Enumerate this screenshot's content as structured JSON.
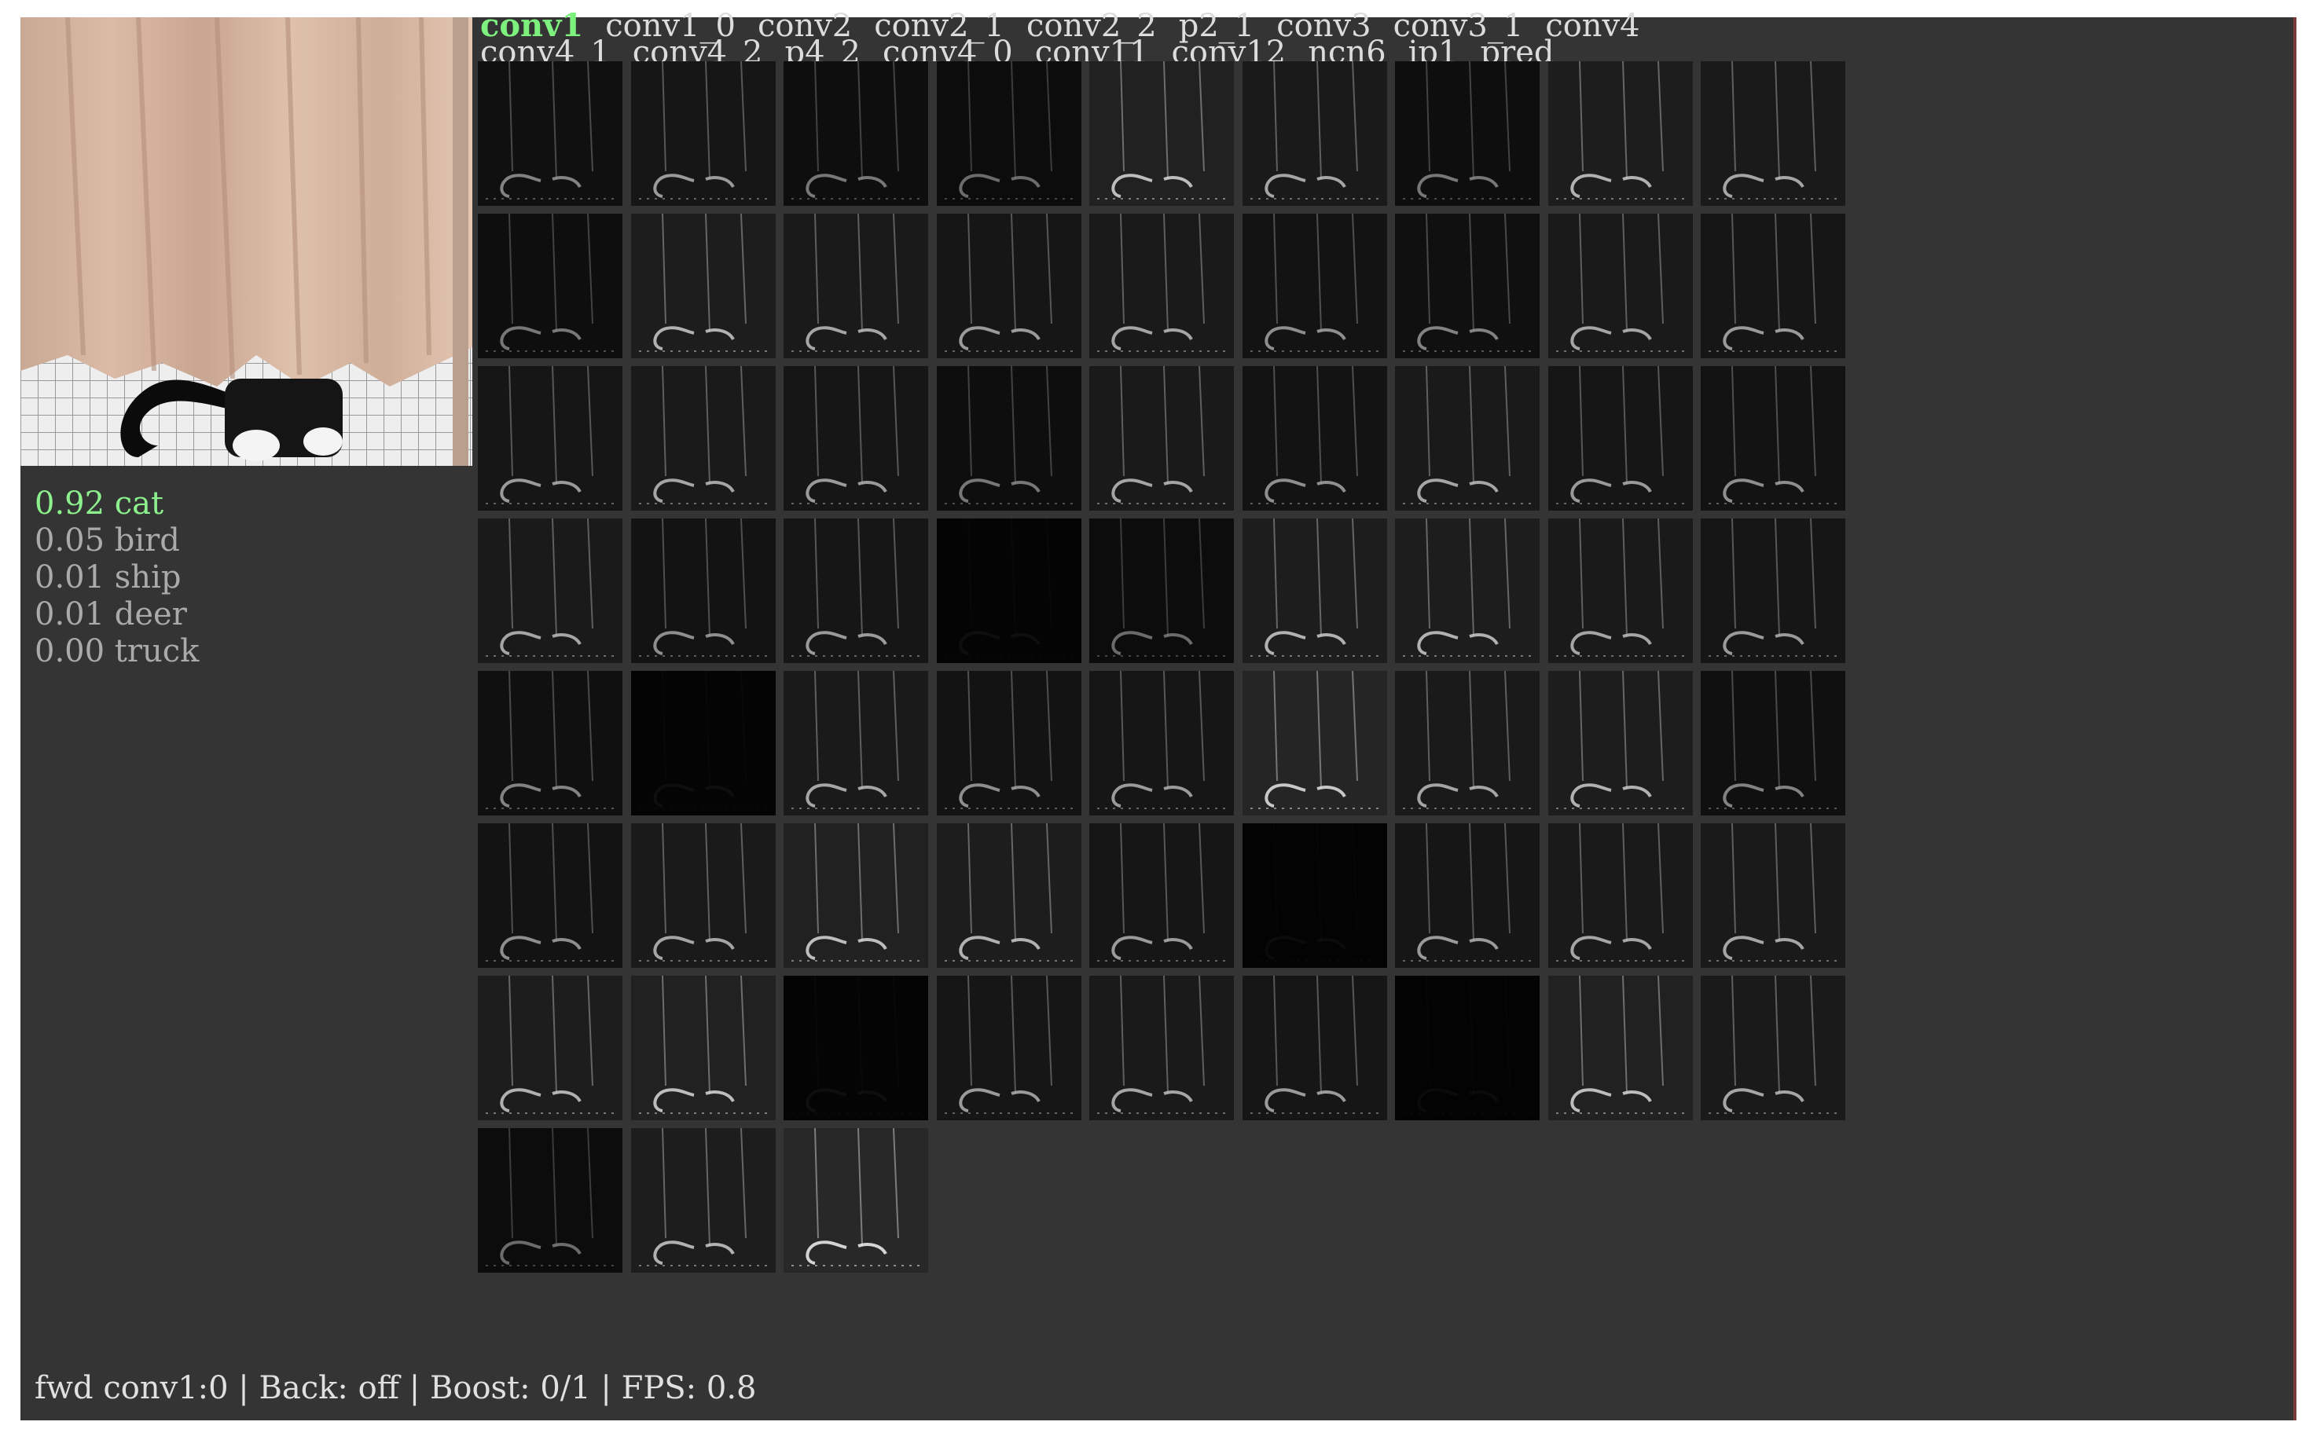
{
  "layer_tabs": {
    "row1": [
      "conv1",
      "conv1_0",
      "conv2",
      "conv2_1",
      "conv2_2",
      "p2_1",
      "conv3",
      "conv3_1",
      "conv4"
    ],
    "row2": [
      "conv4_1",
      "conv4_2",
      "p4_2",
      "conv4_0",
      "conv11",
      "conv12",
      "ncn6",
      "ip1",
      "pred"
    ],
    "active": "conv1"
  },
  "predictions": [
    {
      "score": "0.92",
      "label": "cat"
    },
    {
      "score": "0.05",
      "label": "bird"
    },
    {
      "score": "0.01",
      "label": "ship"
    },
    {
      "score": "0.01",
      "label": "deer"
    },
    {
      "score": "0.00",
      "label": "truck"
    }
  ],
  "activation_grid": {
    "columns": 9,
    "tiles": [
      0.35,
      0.45,
      0.3,
      0.25,
      0.6,
      0.5,
      0.3,
      0.55,
      0.5,
      0.3,
      0.55,
      0.5,
      0.45,
      0.5,
      0.4,
      0.35,
      0.5,
      0.45,
      0.45,
      0.5,
      0.45,
      0.3,
      0.5,
      0.4,
      0.5,
      0.45,
      0.4,
      0.5,
      0.4,
      0.45,
      0.05,
      0.25,
      0.55,
      0.55,
      0.5,
      0.45,
      0.35,
      0.05,
      0.5,
      0.4,
      0.45,
      0.65,
      0.5,
      0.55,
      0.35,
      0.4,
      0.5,
      0.6,
      0.55,
      0.45,
      0.0,
      0.45,
      0.5,
      0.5,
      0.55,
      0.6,
      0.05,
      0.45,
      0.5,
      0.45,
      0.0,
      0.6,
      0.5,
      0.25,
      0.55,
      0.7
    ]
  },
  "status_bar": "fwd conv1:0 | Back: off | Boost: 0/1 | FPS: 0.8",
  "colors": {
    "background": "#343434",
    "active_tab": "#7ef07e",
    "top_prediction": "#8cf08c",
    "text": "#dcdcdc",
    "muted_text": "#aaaaaa"
  }
}
